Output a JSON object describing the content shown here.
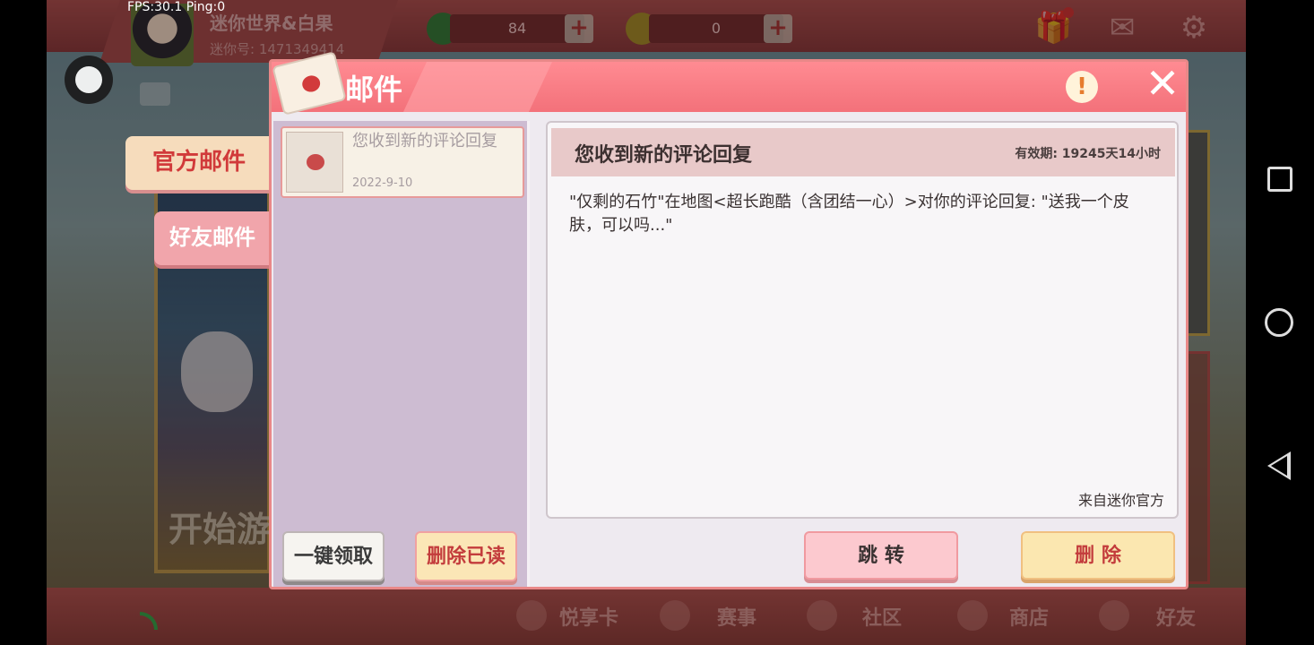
{
  "overlay": {
    "fps_text": "FPS:30.1 Ping:0"
  },
  "topbar": {
    "username": "迷你世界&白果",
    "user_id": "迷你号: 1471349414",
    "currency_gems": "84",
    "currency_coins": "0"
  },
  "side_tabs": {
    "official": "官方邮件",
    "friend": "好友邮件"
  },
  "dialog": {
    "title": "邮件",
    "info_symbol": "!",
    "close_symbol": "✕"
  },
  "mail_list": [
    {
      "subject": "您收到新的评论回复",
      "date": "2022-9-10"
    }
  ],
  "left_buttons": {
    "claim_all": "一键领取",
    "delete_read": "删除已读"
  },
  "mail_detail": {
    "title": "您收到新的评论回复",
    "validity": "有效期: 19245天14小时",
    "body": "\"仅剩的石竹\"在地图<超长跑酷（含团结一心）>对你的评论回复: \"送我一个皮肤，可以吗...\"",
    "sender": "来自迷你官方"
  },
  "detail_buttons": {
    "jump": "跳 转",
    "delete": "删 除"
  },
  "bottom_nav": [
    "悦享卡",
    "赛事",
    "社区",
    "商店",
    "好友"
  ],
  "background": {
    "start_game": "开始游"
  },
  "colors": {
    "header_pink": "#f3717a",
    "accent_red": "#c33c3c",
    "panel_purple": "#cdbcd2"
  }
}
